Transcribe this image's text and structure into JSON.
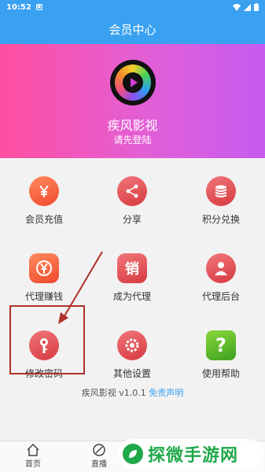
{
  "status_bar": {
    "time": "10:52"
  },
  "header": {
    "title": "会员中心"
  },
  "profile": {
    "app_name": "疾风影视",
    "login_hint": "请先登陆"
  },
  "menu": [
    {
      "label": "会员充值",
      "icon": "yen-icon"
    },
    {
      "label": "分享",
      "icon": "share-icon"
    },
    {
      "label": "积分兑换",
      "icon": "coins-icon"
    },
    {
      "label": "代理赚钱",
      "icon": "yen-wallet-icon"
    },
    {
      "label": "成为代理",
      "icon": "sale-icon",
      "glyph": "销"
    },
    {
      "label": "代理后台",
      "icon": "user-icon"
    },
    {
      "label": "修改密码",
      "icon": "key-icon"
    },
    {
      "label": "其他设置",
      "icon": "settings-icon"
    },
    {
      "label": "使用帮助",
      "icon": "help-icon",
      "glyph": "?"
    }
  ],
  "footer": {
    "version_text": "疾风影视 v1.0.1",
    "disclaimer": "免责声明"
  },
  "bottom_nav": [
    {
      "label": "首页",
      "icon": "home-icon"
    },
    {
      "label": "直播",
      "icon": "live-icon"
    }
  ],
  "watermark": {
    "text": "探微手游网"
  },
  "colors": {
    "primary": "#3aa0f0",
    "hero_start": "#ff4fa0",
    "hero_end": "#c65cf0",
    "annotation": "#b0302a"
  }
}
